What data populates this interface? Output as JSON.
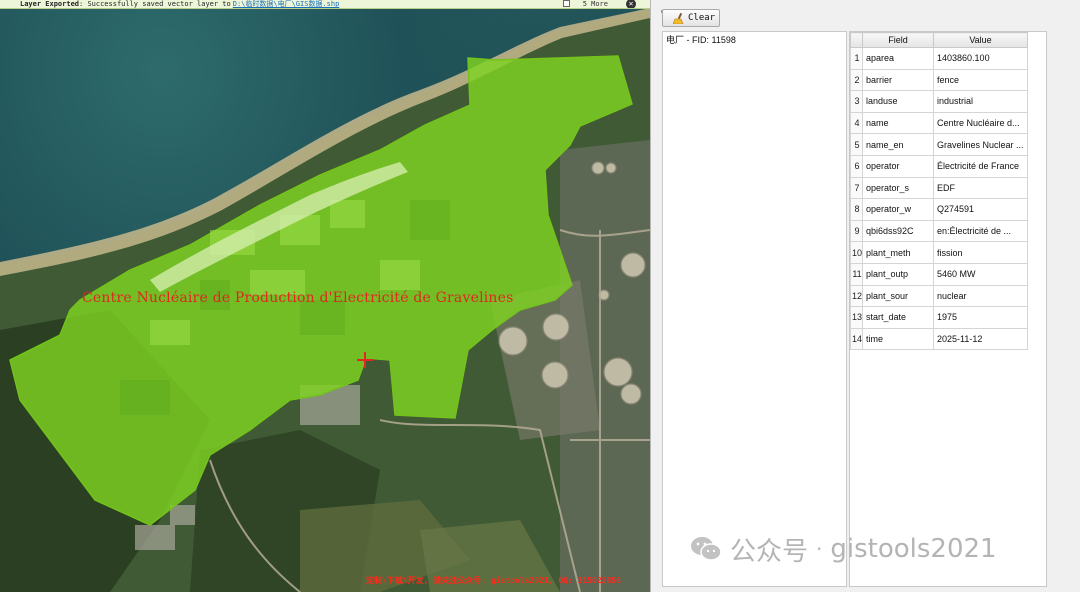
{
  "message_bar": {
    "title": "Layer Exported",
    "text": ": Successfully saved vector layer to",
    "link": "D:\\临时数据\\电厂\\GIS数据.shp",
    "extra": "5 More",
    "close_icon": "close-icon"
  },
  "map": {
    "feature_label": "Centre Nucléaire de Production d'Electricité de Gravelines",
    "marker_icon": "crosshair-icon",
    "watermark": "定制\\下载\\开发, 请关注公众号: gistools2021, QQ: 315022858",
    "polygon_fill": "#7fd322",
    "label_color": "#e3261f"
  },
  "panel": {
    "clear_button": "Clear",
    "tree_item": "电厂 - FID: 11598",
    "table": {
      "headers": [
        "Field",
        "Value"
      ],
      "rows": [
        {
          "idx": "1",
          "field": "aparea",
          "value": "1403860.100"
        },
        {
          "idx": "2",
          "field": "barrier",
          "value": "fence"
        },
        {
          "idx": "3",
          "field": "landuse",
          "value": "industrial"
        },
        {
          "idx": "4",
          "field": "name",
          "value": "Centre Nucléaire d..."
        },
        {
          "idx": "5",
          "field": "name_en",
          "value": "Gravelines Nuclear ..."
        },
        {
          "idx": "6",
          "field": "operator",
          "value": "Électricité de France"
        },
        {
          "idx": "7",
          "field": "operator_s",
          "value": "EDF"
        },
        {
          "idx": "8",
          "field": "operator_w",
          "value": "Q274591"
        },
        {
          "idx": "9",
          "field": "qbi6dss92C",
          "value": "en:Électricité de ..."
        },
        {
          "idx": "10",
          "field": "plant_meth",
          "value": "fission"
        },
        {
          "idx": "11",
          "field": "plant_outp",
          "value": "5460 MW"
        },
        {
          "idx": "12",
          "field": "plant_sour",
          "value": "nuclear"
        },
        {
          "idx": "13",
          "field": "start_date",
          "value": "1975"
        },
        {
          "idx": "14",
          "field": "time",
          "value": "2025-11-12"
        }
      ]
    }
  },
  "overlay_watermark": {
    "brand": "公众号",
    "separator": "·",
    "account": "gistools2021"
  }
}
